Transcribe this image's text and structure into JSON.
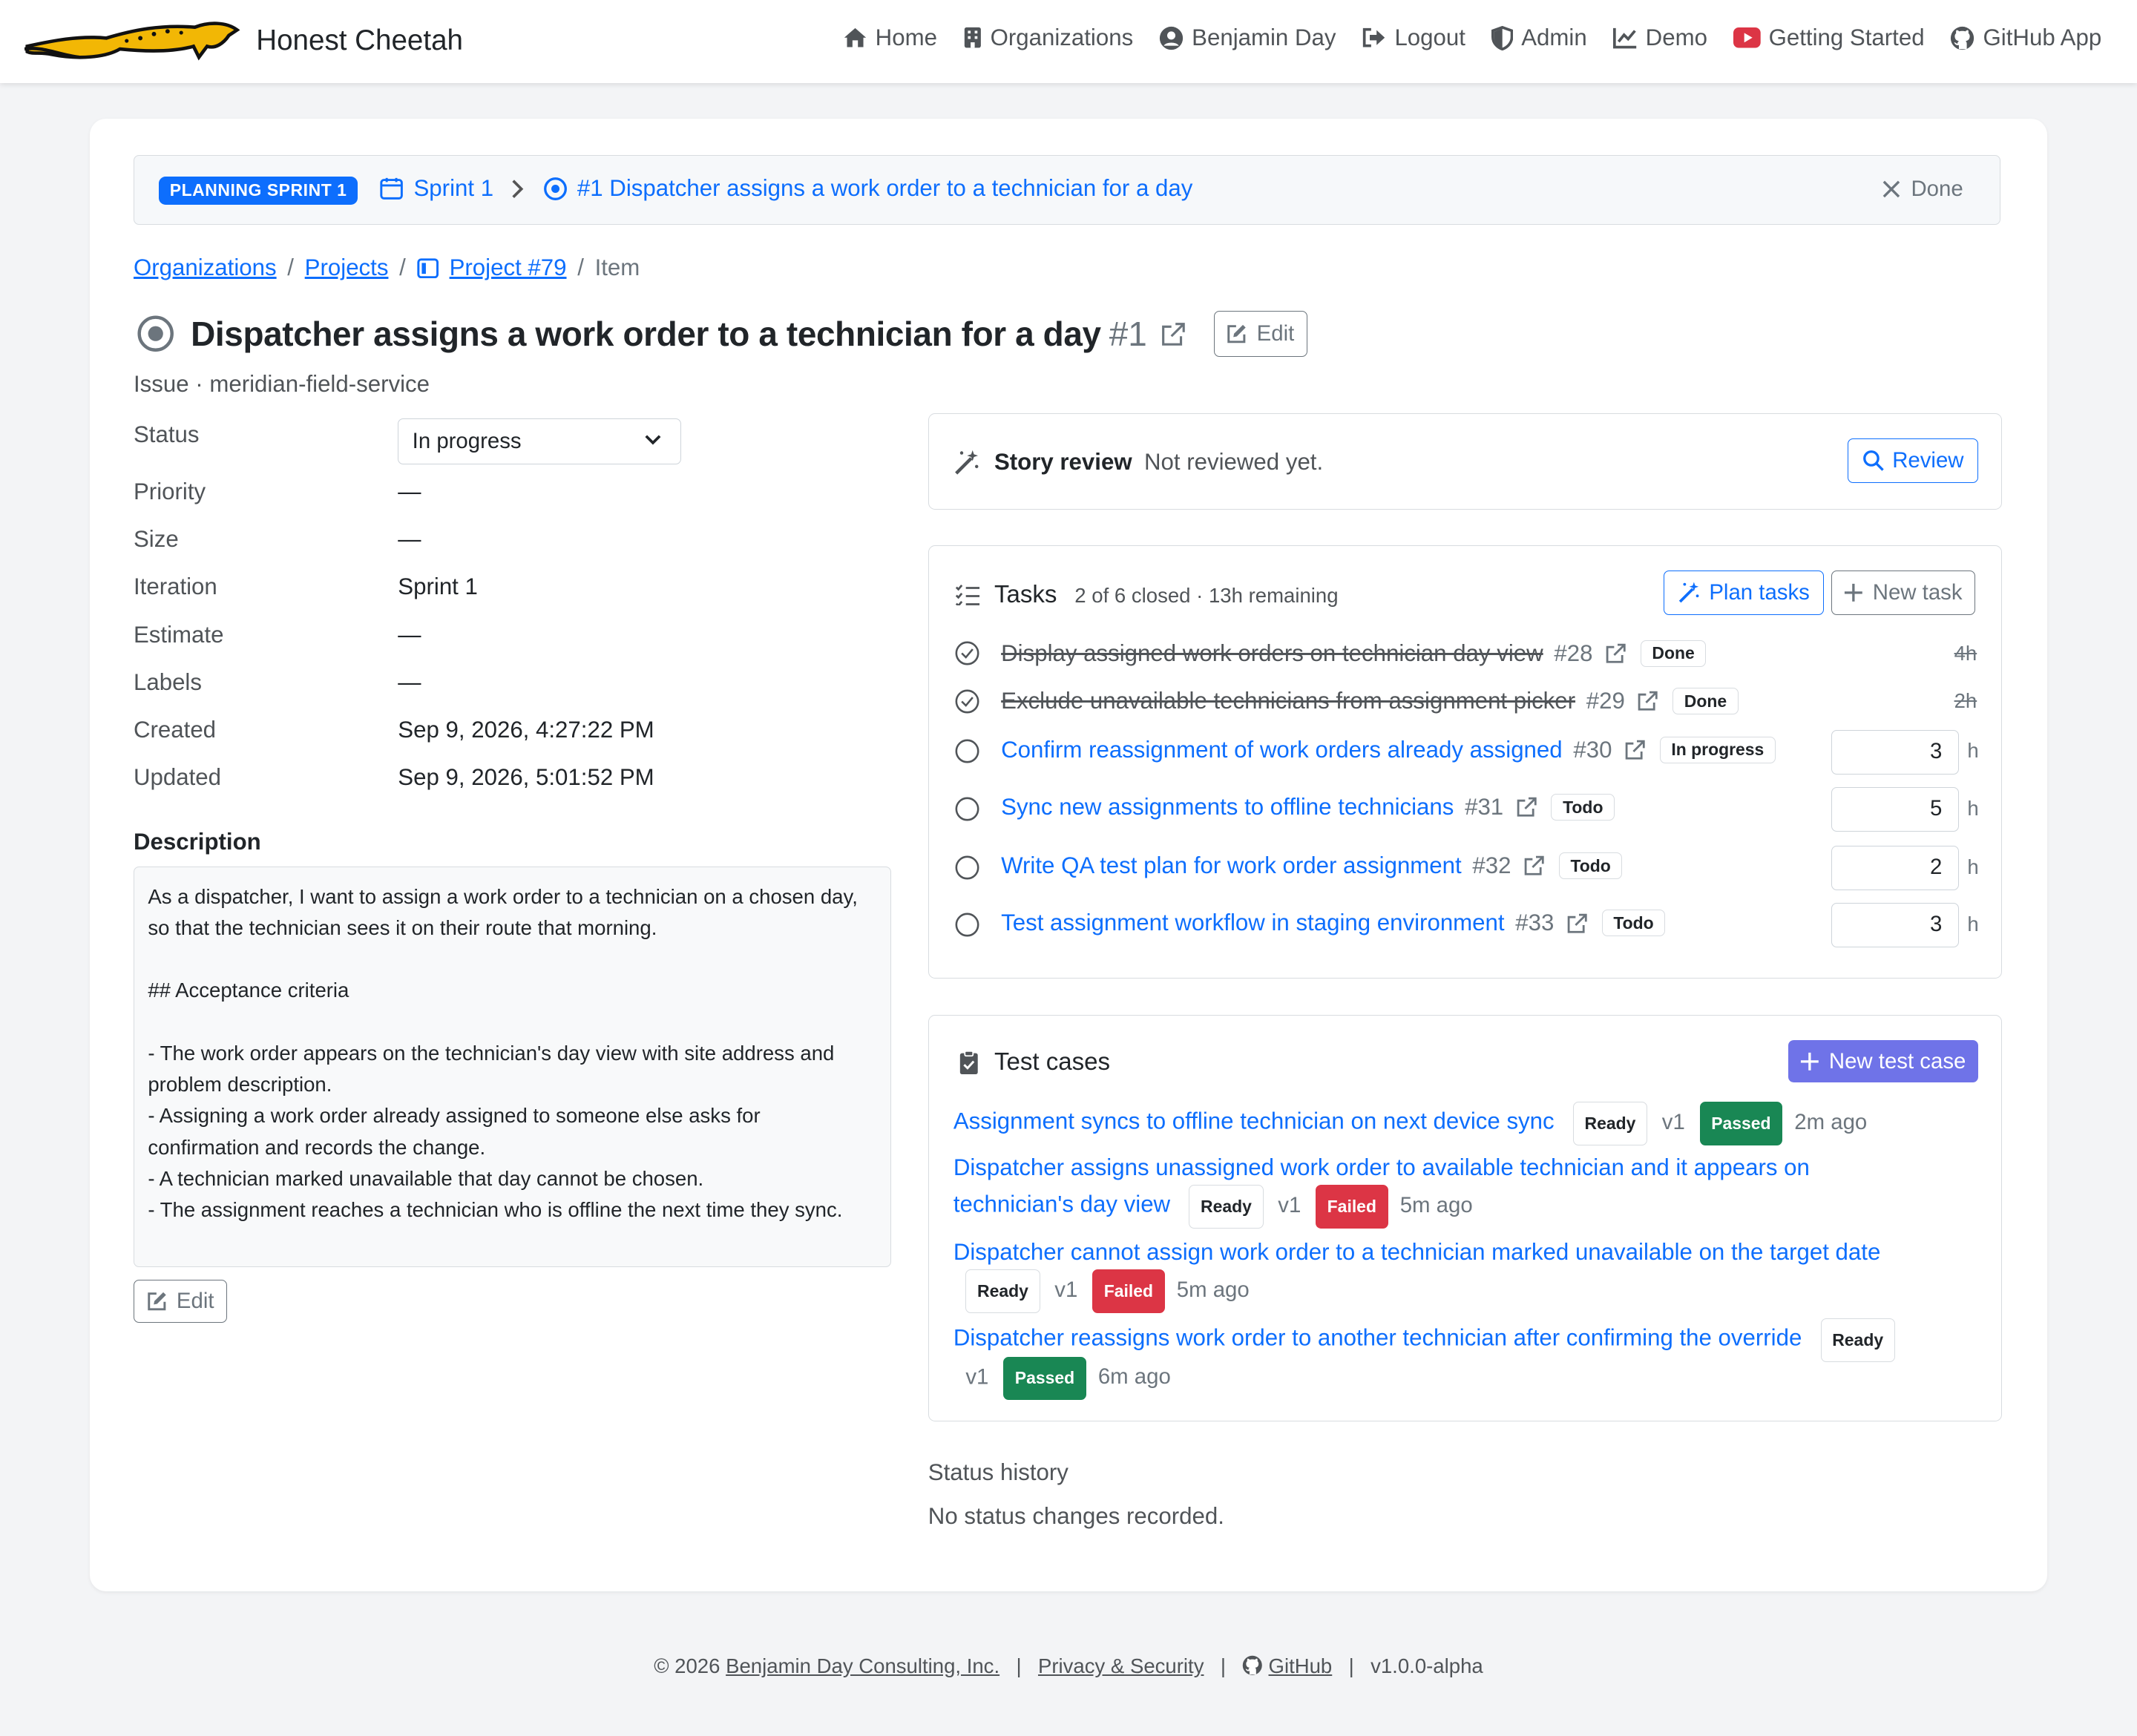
{
  "brand": {
    "name": "Honest Cheetah"
  },
  "nav": [
    {
      "label": "Home",
      "icon": "home-icon"
    },
    {
      "label": "Organizations",
      "icon": "building-icon"
    },
    {
      "label": "Benjamin Day",
      "icon": "user-circle-icon"
    },
    {
      "label": "Logout",
      "icon": "logout-icon"
    },
    {
      "label": "Admin",
      "icon": "shield-icon"
    },
    {
      "label": "Demo",
      "icon": "chart-line-icon"
    },
    {
      "label": "Getting Started",
      "icon": "youtube-icon"
    },
    {
      "label": "GitHub App",
      "icon": "github-icon"
    }
  ],
  "sprint_bar": {
    "badge": "PLANNING SPRINT 1",
    "sprint": "Sprint 1",
    "item": "#1 Dispatcher assigns a work order to a technician for a day",
    "done": "Done"
  },
  "breadcrumb": {
    "organizations": "Organizations",
    "projects": "Projects",
    "project": "Project #79",
    "current": "Item"
  },
  "item": {
    "title": "Dispatcher assigns a work order to a technician for a day",
    "number": "#1",
    "edit": "Edit",
    "subtitle": "Issue · meridian-field-service"
  },
  "fields": {
    "status_label": "Status",
    "status_value": "In progress",
    "priority_label": "Priority",
    "priority_value": "—",
    "size_label": "Size",
    "size_value": "—",
    "iteration_label": "Iteration",
    "iteration_value": "Sprint 1",
    "estimate_label": "Estimate",
    "estimate_value": "—",
    "labels_label": "Labels",
    "labels_value": "—",
    "created_label": "Created",
    "created_value": "Sep 9, 2026, 4:27:22 PM",
    "updated_label": "Updated",
    "updated_value": "Sep 9, 2026, 5:01:52 PM"
  },
  "description": {
    "heading": "Description",
    "text": "As a dispatcher, I want to assign a work order to a technician on a chosen day, so that the technician sees it on their route that morning.\n\n## Acceptance criteria\n\n- The work order appears on the technician's day view with site address and problem description.\n- Assigning a work order already assigned to someone else asks for confirmation and records the change.\n- A technician marked unavailable that day cannot be chosen.\n- The assignment reaches a technician who is offline the next time they sync.",
    "edit": "Edit"
  },
  "story_review": {
    "title": "Story review",
    "status": "Not reviewed yet.",
    "button": "Review"
  },
  "tasks": {
    "title": "Tasks",
    "summary": "2 of 6 closed · 13h remaining",
    "plan_button": "Plan tasks",
    "new_button": "New task",
    "items": [
      {
        "title": "Display assigned work orders on technician day view",
        "number": "#28",
        "status": "Done",
        "hours": "4h",
        "unit": ""
      },
      {
        "title": "Exclude unavailable technicians from assignment picker",
        "number": "#29",
        "status": "Done",
        "hours": "2h",
        "unit": ""
      },
      {
        "title": "Confirm reassignment of work orders already assigned",
        "number": "#30",
        "status": "In progress",
        "hours": "3",
        "unit": "h"
      },
      {
        "title": "Sync new assignments to offline technicians",
        "number": "#31",
        "status": "Todo",
        "hours": "5",
        "unit": "h"
      },
      {
        "title": "Write QA test plan for work order assignment",
        "number": "#32",
        "status": "Todo",
        "hours": "2",
        "unit": "h"
      },
      {
        "title": "Test assignment workflow in staging environment",
        "number": "#33",
        "status": "Todo",
        "hours": "3",
        "unit": "h"
      }
    ]
  },
  "test_cases": {
    "title": "Test cases",
    "new_button": "New test case",
    "items": [
      {
        "title": "Assignment syncs to offline technician on next device sync",
        "state": "Ready",
        "version": "v1",
        "result": "Passed",
        "time": "2m ago"
      },
      {
        "title_line1": "Dispatcher assigns unassigned work order to available technician and it appears on",
        "title_line2": "technician's day view",
        "state": "Ready",
        "version": "v1",
        "result": "Failed",
        "time": "5m ago"
      },
      {
        "title": "Dispatcher cannot assign work order to a technician marked unavailable on the target date",
        "state": "Ready",
        "version": "v1",
        "result": "Failed",
        "time": "5m ago"
      },
      {
        "title": "Dispatcher reassigns work order to another technician after confirming the override",
        "state": "Ready",
        "version": "v1",
        "result": "Passed",
        "time": "6m ago"
      }
    ]
  },
  "status_history": {
    "title": "Status history",
    "empty": "No status changes recorded."
  },
  "footer": {
    "copyright": "© 2026",
    "company": "Benjamin Day Consulting, Inc.",
    "privacy": "Privacy & Security",
    "github": "GitHub",
    "version": "v1.0.0-alpha"
  },
  "colors": {
    "primary": "#0d6efd",
    "success": "#198754",
    "danger": "#dc3545",
    "purple": "#6f73e8",
    "cheetah": "#f2b705"
  }
}
